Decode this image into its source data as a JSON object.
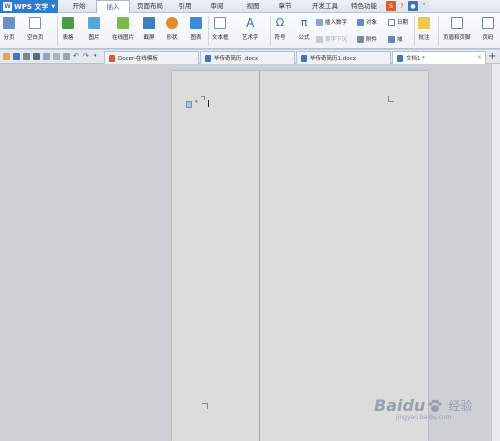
{
  "app": {
    "name": "WPS 文字"
  },
  "menu": {
    "tabs": [
      {
        "label": "开始"
      },
      {
        "label": "插入"
      },
      {
        "label": "页面布局"
      },
      {
        "label": "引用"
      },
      {
        "label": "审阅"
      },
      {
        "label": "视图"
      },
      {
        "label": "章节"
      },
      {
        "label": "开发工具"
      },
      {
        "label": "特色功能"
      }
    ],
    "active_tab": "插入"
  },
  "ribbon": {
    "fenye": "分页",
    "kongbaiye": "空白页",
    "biaoge": "表格",
    "tupian": "图片",
    "zaixiantupian": "在线图片",
    "jieping": "截屏",
    "xingzhuang": "形状",
    "tubiao": "图表",
    "wenbenkuang": "文本框",
    "yishuzi": "艺术字",
    "fuhao": "符号",
    "gongshi": "公式",
    "charushuzi": "插入数字",
    "duixiang": "对象",
    "riqi": "日期",
    "shouzixiachen": "首字下沉",
    "fujian": "附件",
    "yu": "域",
    "pizhu": "批注",
    "yemeiheyejiao": "页眉和页脚",
    "yema": "页码"
  },
  "tabbar": {
    "tabs": [
      {
        "label": "Docer-在线模板"
      },
      {
        "label": "毕传奇简历 .docx"
      },
      {
        "label": "毕传奇简历1.docx"
      },
      {
        "label": "文档1 *"
      }
    ]
  },
  "watermark": {
    "brand": "Baidu",
    "suffix": "经验",
    "url": "jingyan.baidu.com"
  },
  "colors": {
    "accent": "#2e7bcf",
    "page": "#dcdcdc",
    "workspace": "#cdd0d4"
  }
}
